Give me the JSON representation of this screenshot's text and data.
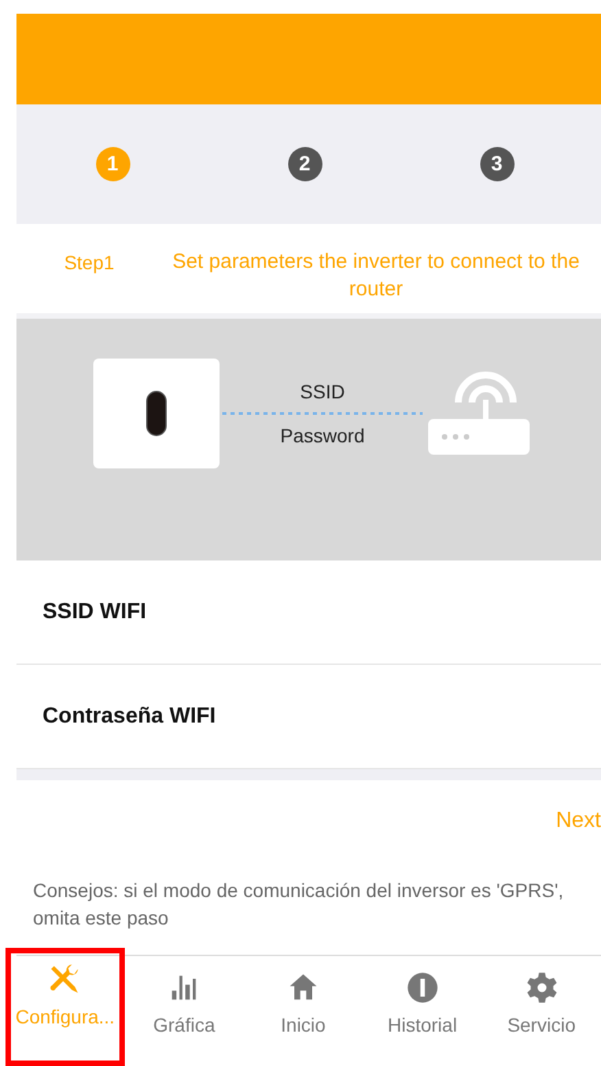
{
  "steps": [
    {
      "number": "1",
      "selected": true
    },
    {
      "number": "2",
      "selected": false
    },
    {
      "number": "3",
      "selected": false
    }
  ],
  "step_info": {
    "label": "Step1",
    "description": "Set parameters the inverter to connect to the router"
  },
  "diagram": {
    "top_label": "SSID",
    "bottom_label": "Password"
  },
  "fields": [
    {
      "label": "SSID WIFI"
    },
    {
      "label": "Contraseña WIFI"
    }
  ],
  "next_button": "Next",
  "tip": "Consejos: si el modo de comunicación del inversor es 'GPRS', omita este paso",
  "tab_bar": [
    {
      "label": "Configura...",
      "selected": true,
      "highlighted": true
    },
    {
      "label": "Gráfica",
      "selected": false,
      "highlighted": false
    },
    {
      "label": "Inicio",
      "selected": false,
      "highlighted": false
    },
    {
      "label": "Historial",
      "selected": false,
      "highlighted": false
    },
    {
      "label": "Servicio",
      "selected": false,
      "highlighted": false
    }
  ]
}
